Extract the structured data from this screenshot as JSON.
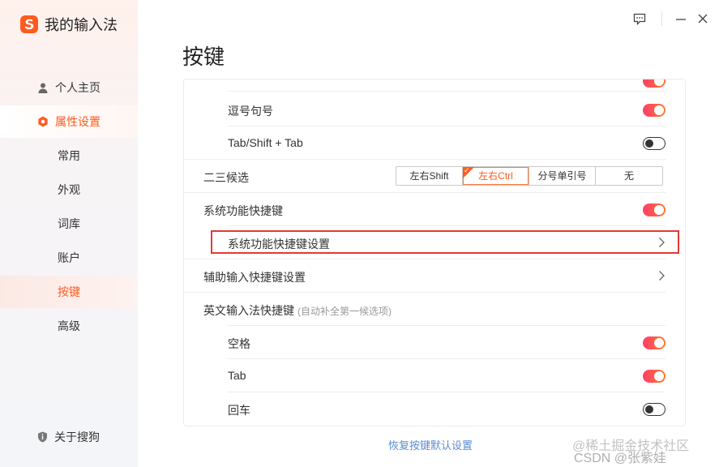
{
  "app": {
    "name": "我的输入法"
  },
  "sidebar": {
    "items": [
      {
        "label": "个人主页"
      },
      {
        "label": "属性设置"
      }
    ],
    "sub_items": [
      {
        "label": "常用"
      },
      {
        "label": "外观"
      },
      {
        "label": "词库"
      },
      {
        "label": "账户"
      },
      {
        "label": "按键"
      },
      {
        "label": "高级"
      }
    ],
    "about_label": "关于搜狗"
  },
  "page": {
    "title": "按键"
  },
  "settings": {
    "rows": [
      {
        "label": "逗号句号",
        "toggle": "on"
      },
      {
        "label": "Tab/Shift + Tab",
        "toggle": "off"
      },
      {
        "label": "二三候选"
      },
      {
        "label": "系统功能快捷键",
        "toggle": "on"
      },
      {
        "label": "系统功能快捷键设置"
      },
      {
        "label": "辅助输入快捷键设置"
      },
      {
        "label": "英文输入法快捷键",
        "hint": "(自动补全第一候选项)"
      },
      {
        "label": "空格",
        "toggle": "on"
      },
      {
        "label": "Tab",
        "toggle": "on"
      },
      {
        "label": "回车",
        "toggle": "off"
      }
    ],
    "candidate_options": [
      "左右Shift",
      "左右Ctrl",
      "分号单引号",
      "无"
    ],
    "candidate_selected": "左右Ctrl"
  },
  "footer": {
    "restore_label": "恢复按键默认设置"
  },
  "watermark": {
    "line1": "@稀土掘金技术社区",
    "line2": "CSDN @张紫娃"
  },
  "colors": {
    "accent": "#ff5a1f",
    "toggle_on_start": "#ff3d6a",
    "toggle_on_end": "#ff7a2f",
    "highlight": "#e53935",
    "link": "#5b8ccf"
  }
}
